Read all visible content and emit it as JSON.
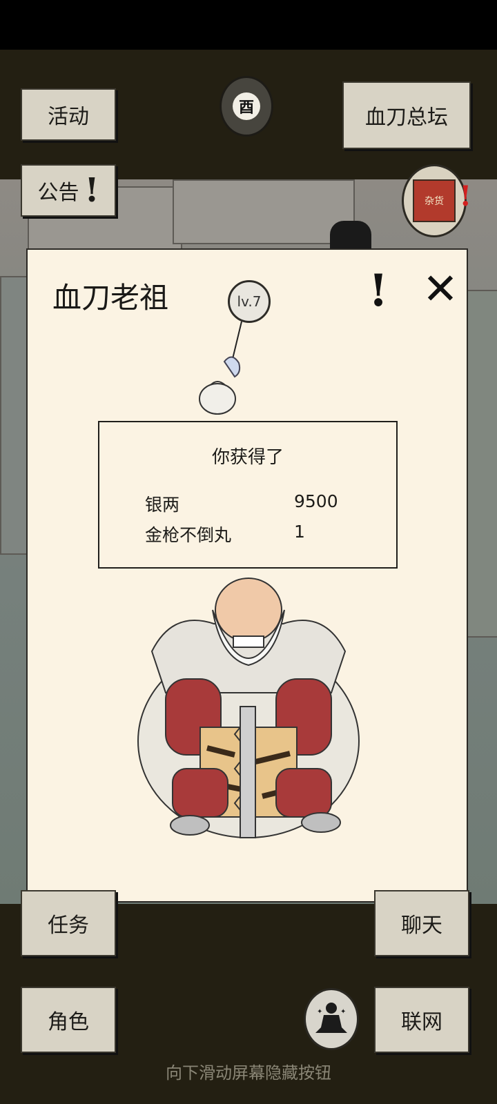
{
  "top_buttons": {
    "events": "活动",
    "notice": "公告",
    "guild": "血刀总坛"
  },
  "hour_badge": "酉",
  "shop_sign": "杂货",
  "dialog": {
    "title": "血刀老祖",
    "level": "lv.7",
    "reward": {
      "title": "你获得了",
      "items": [
        {
          "name": "银两",
          "qty": "9500"
        },
        {
          "name": "金枪不倒丸",
          "qty": "1"
        }
      ]
    }
  },
  "bottom_buttons": {
    "tasks": "任务",
    "character": "角色",
    "chat": "聊天",
    "online": "联网"
  },
  "hint": "向下滑动屏幕隐藏按钮",
  "colors": {
    "hud_bg": "#231f12",
    "button_bg": "#d8d3c5",
    "dialog_bg": "#fbf3e3",
    "robe_red": "#a83a3a"
  }
}
